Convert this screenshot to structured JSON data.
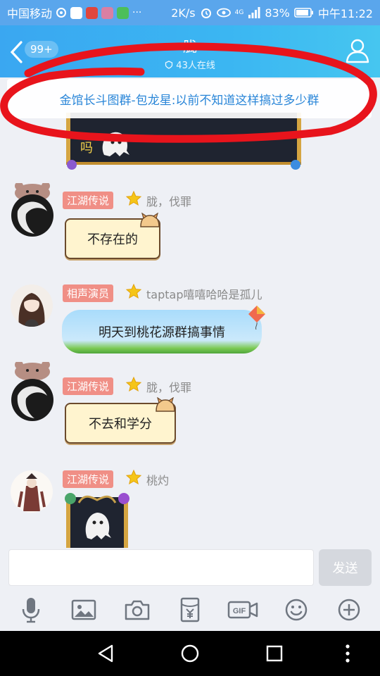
{
  "status_bar": {
    "carrier": "中国移动",
    "network_speed": "2K/s",
    "battery": "83%",
    "time": "中午11:22",
    "signal_label": "4G"
  },
  "header": {
    "title": "胧",
    "online_count": "43人在线",
    "unread_badge": "99+"
  },
  "announcement": {
    "text": "金馆长斗图群-包龙星:以前不知道这样搞过多少群"
  },
  "messages": [
    {
      "rank": "江湖传说",
      "sender": "胧，伐罪",
      "text": "不存在的"
    },
    {
      "rank": "相声演员",
      "sender": "taptap嘻嘻哈哈是孤儿",
      "text": "明天到桃花源群搞事情"
    },
    {
      "rank": "江湖传说",
      "sender": "胧，伐罪",
      "text": "不去和学分"
    },
    {
      "rank": "江湖传说",
      "sender": "桃灼",
      "text": ""
    }
  ],
  "partial_top_message": {
    "text": "吗"
  },
  "input": {
    "placeholder": "",
    "value": "",
    "send_label": "发送"
  },
  "toolbar": {
    "items": [
      "microphone-icon",
      "image-icon",
      "camera-icon",
      "red-packet-icon",
      "gif-icon",
      "emoji-icon",
      "plus-icon"
    ],
    "gif_label": "GIF"
  },
  "colors": {
    "accent": "#3aa7f1",
    "rank_badge": "#f08f86",
    "announcement_text": "#2a86d8",
    "annotation_ring": "#e8141c"
  }
}
